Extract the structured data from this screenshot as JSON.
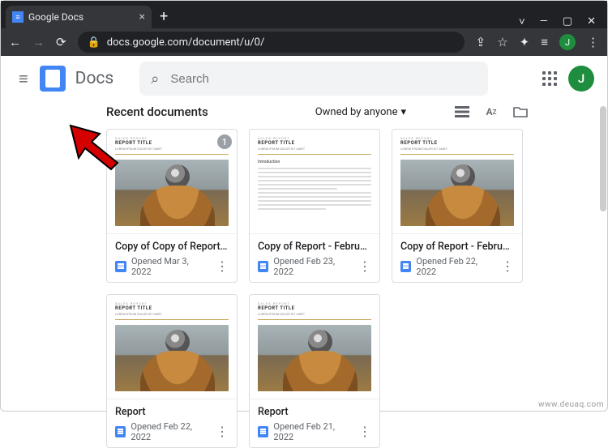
{
  "browser": {
    "tab_title": "Google Docs",
    "url": "docs.google.com/document/u/0/",
    "profile_letter": "J"
  },
  "header": {
    "app_name": "Docs",
    "search_placeholder": "Search",
    "profile_letter": "J"
  },
  "content": {
    "recent_label": "Recent documents",
    "owner_filter": "Owned by anyone",
    "docs": [
      {
        "title": "Copy of Copy of Report - ...",
        "opened": "Opened Mar 3, 2022",
        "badge": "1",
        "thumb": "photo"
      },
      {
        "title": "Copy of Report - Februar...",
        "opened": "Opened Feb 23, 2022",
        "thumb": "text"
      },
      {
        "title": "Copy of Report - Februar...",
        "opened": "Opened Feb 22, 2022",
        "thumb": "photo"
      },
      {
        "title": "Report",
        "opened": "Opened Feb 22, 2022",
        "thumb": "photo"
      },
      {
        "title": "Report",
        "opened": "Opened Feb 21, 2022",
        "thumb": "photo"
      }
    ]
  },
  "watermark": "www.deuaq.com"
}
